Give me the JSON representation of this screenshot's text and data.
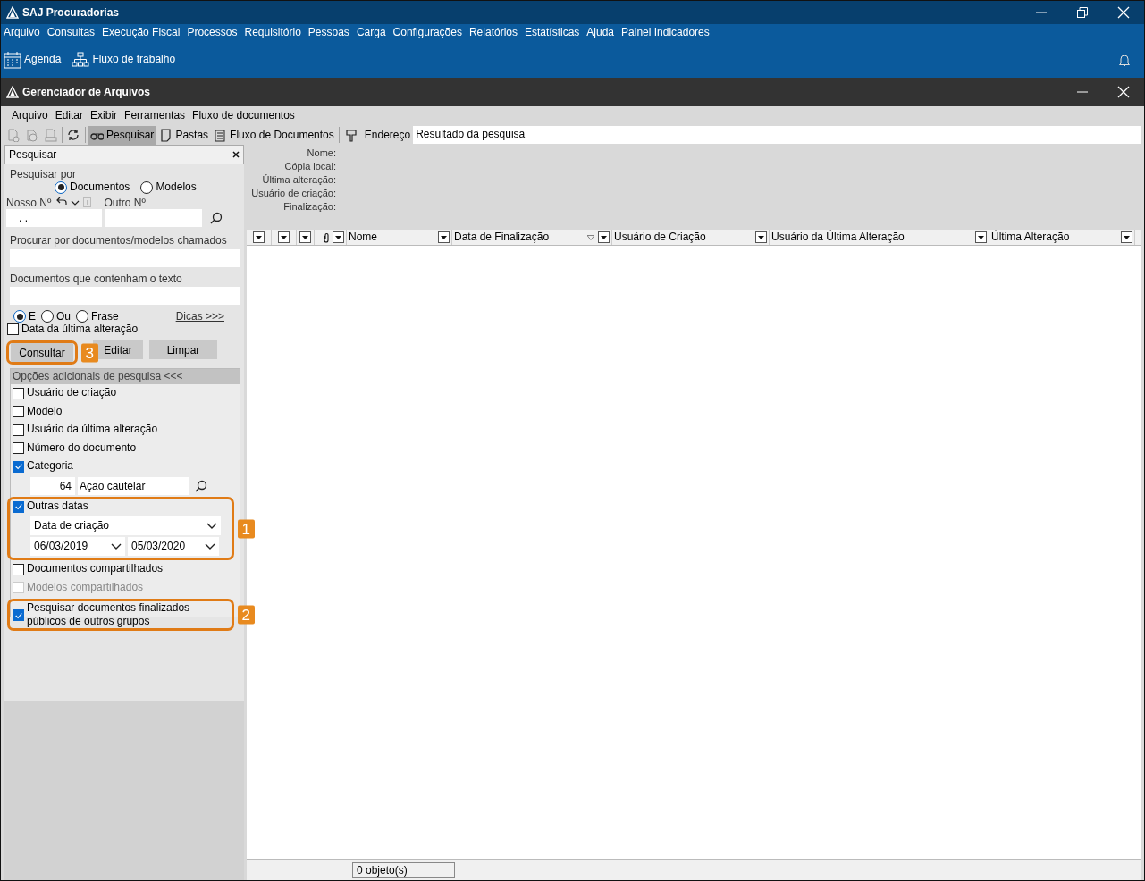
{
  "app_window": {
    "title": "SAJ Procuradorias"
  },
  "main_menu": [
    "Arquivo",
    "Consultas",
    "Execução Fiscal",
    "Processos",
    "Requisitório",
    "Pessoas",
    "Carga",
    "Configurações",
    "Relatórios",
    "Estatísticas",
    "Ajuda",
    "Painel Indicadores"
  ],
  "quick_toolbar": [
    {
      "label": "Agenda",
      "kind": "calendar"
    },
    {
      "label": "Fluxo de trabalho",
      "kind": "workflow"
    }
  ],
  "file_manager": {
    "title": "Gerenciador de Arquivos",
    "menu": [
      "Arquivo",
      "Editar",
      "Exibir",
      "Ferramentas",
      "Fluxo de documentos"
    ],
    "toolbar": [
      {
        "kind": "new-document",
        "disabled": true
      },
      {
        "kind": "add-document",
        "disabled": true
      },
      {
        "kind": "print-document",
        "disabled": true
      },
      {
        "kind": "refresh",
        "disabled": false
      },
      {
        "kind": "search",
        "label": "Pesquisar",
        "selected": true
      },
      {
        "kind": "folders",
        "label": "Pastas",
        "selected": false
      },
      {
        "kind": "flow",
        "label": "Fluxo de Documentos",
        "selected": false
      }
    ],
    "address": {
      "label": "Endereço",
      "value": "Resultado da pesquisa"
    }
  },
  "search_panel": {
    "title": "Pesquisar",
    "search_by": {
      "label": "Pesquisar por",
      "options": [
        {
          "label": "Documentos",
          "selected": true
        },
        {
          "label": "Modelos",
          "selected": false
        }
      ]
    },
    "our_number": {
      "label": "Nosso Nº",
      "value": ". ."
    },
    "other_number": {
      "label": "Outro Nº"
    },
    "name_field": {
      "label": "Procurar por documentos/modelos chamados"
    },
    "text_field": {
      "label": "Documentos que contenham o texto"
    },
    "operators": [
      {
        "label": "E",
        "selected": true
      },
      {
        "label": "Ou",
        "selected": false
      },
      {
        "label": "Frase",
        "selected": false
      }
    ],
    "tips_link": "Dicas >>>",
    "last_change": {
      "label": "Data da última alteração",
      "checked": false
    },
    "buttons": [
      {
        "label": "Consultar",
        "callout": "3"
      },
      {
        "label": "Editar"
      },
      {
        "label": "Limpar"
      }
    ],
    "additional": {
      "title": "Opções adicionais de pesquisa <<<",
      "items": [
        {
          "kind": "checkbox",
          "label": "Usuário de criação",
          "checked": false,
          "disabled": false
        },
        {
          "kind": "checkbox",
          "label": "Modelo",
          "checked": false,
          "disabled": false
        },
        {
          "kind": "checkbox",
          "label": "Usuário da última alteração",
          "checked": false,
          "disabled": false
        },
        {
          "kind": "checkbox",
          "label": "Número do documento",
          "checked": false,
          "disabled": false
        },
        {
          "kind": "category",
          "label": "Categoria",
          "checked": true,
          "disabled": false,
          "code": "64",
          "value": "Ação cautelar"
        },
        {
          "kind": "dates",
          "label": "Outras datas",
          "checked": true,
          "disabled": false,
          "date_type": "Data de criação",
          "from": "06/03/2019",
          "to": "05/03/2020",
          "callout": "1"
        },
        {
          "kind": "checkbox",
          "label": "Documentos compartilhados",
          "checked": false,
          "disabled": false
        },
        {
          "kind": "checkbox",
          "label": "Modelos compartilhados",
          "checked": false,
          "disabled": true
        },
        {
          "kind": "checkbox",
          "label": "Pesquisar documentos finalizados públicos de outros grupos",
          "checked": true,
          "disabled": false,
          "callout": "2"
        }
      ]
    }
  },
  "details": [
    "Nome:",
    "Cópia local:",
    "Última alteração:",
    "Usuário de criação:",
    "Finalização:"
  ],
  "table": {
    "columns": [
      {
        "kind": "blank"
      },
      {
        "kind": "blank"
      },
      {
        "kind": "blank"
      },
      {
        "kind": "attachment"
      },
      {
        "kind": "text",
        "label": "Nome",
        "filtered": false
      },
      {
        "kind": "text",
        "label": "Data de Finalização",
        "filtered": true
      },
      {
        "kind": "text",
        "label": "Usuário de Criação",
        "filtered": false
      },
      {
        "kind": "text",
        "label": "Usuário da Última Alteração",
        "filtered": false
      },
      {
        "kind": "text",
        "label": "Última Alteração",
        "filtered": false
      }
    ]
  },
  "status_bar": "0 objeto(s)"
}
